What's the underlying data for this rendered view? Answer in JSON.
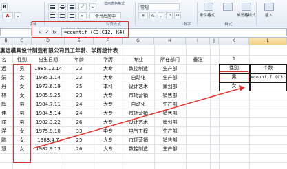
{
  "ribbon": {
    "format_as_table": "套用表格格式",
    "merge_center": "合并后居中",
    "number_format": "常规",
    "cond_format": "条件格式",
    "cell_style": "单元格样式",
    "insert": "插入",
    "groups": {
      "font": "字体",
      "alignment": "对齐方式",
      "number": "数字",
      "styles": "样式"
    }
  },
  "formula_bar": {
    "cancel_icon": "×",
    "enter_icon": "✓",
    "fx_icon": "fx",
    "formula": "=countif (C3:C12, K4)"
  },
  "columns": [
    "B",
    "C",
    "D",
    "E",
    "F",
    "G",
    "H",
    "I",
    "J",
    "K",
    "L"
  ],
  "title": "惠远模具设计制造有限公司员工年龄、学历统计表",
  "table": {
    "headers": [
      "名",
      "性别",
      "出生日期",
      "年龄",
      "学历",
      "专业",
      "所在部门",
      "备注"
    ],
    "rows": [
      [
        "远",
        "男",
        "1985.12.14",
        "23",
        "大专",
        "数控制造",
        "生产部"
      ],
      [
        "娟",
        "女",
        "1985.1.14",
        "23",
        "大专",
        "自动化",
        "生产部"
      ],
      [
        "丹",
        "女",
        "1973.6.19",
        "35",
        "本科",
        "设计艺术",
        "策划部"
      ],
      [
        "林",
        "女",
        "1985.9.25",
        "23",
        "大专",
        "市场营销",
        "销售部"
      ],
      [
        "辉",
        "男",
        "1984.7.11",
        "24",
        "大专",
        "自动化",
        "生产部"
      ],
      [
        "伟",
        "男",
        "1984.5.14",
        "24",
        "大专",
        "市场营销",
        "销售部"
      ],
      [
        "成",
        "男",
        "1982.3.22",
        "26",
        "大专",
        "设计艺术",
        "策划部"
      ],
      [
        "洋",
        "女",
        "1975.9.10",
        "33",
        "中专",
        "电气工程",
        "生产部"
      ],
      [
        "鹏",
        "女",
        "1983.4.7",
        "25",
        "大专",
        "市场营销",
        "销售部"
      ],
      [
        "慧",
        "女",
        "1982.9.13",
        "26",
        "大专",
        "数控制造",
        "生产部"
      ]
    ]
  },
  "summary": {
    "header_gender": "性别",
    "header_count": "个数",
    "male": "男",
    "female": "女",
    "count_formula": "=countif (C3:C12",
    "k3_value": "1"
  },
  "accent_colors": {
    "annotation_red": "#e0322a",
    "ribbon_blue": "#dfe8f3"
  }
}
